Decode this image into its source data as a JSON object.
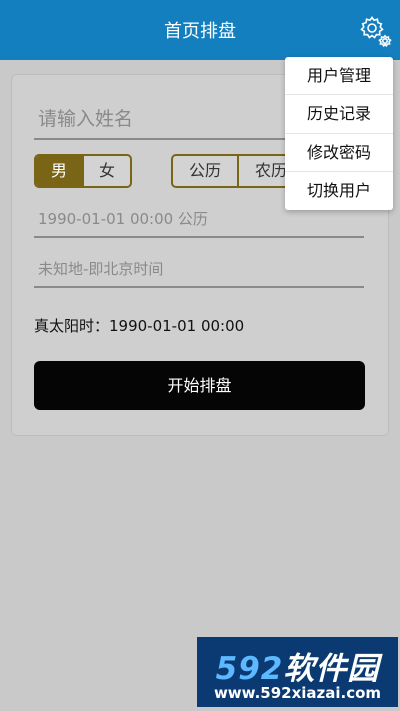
{
  "header": {
    "title": "首页排盘",
    "settings_icon": "gear-icon"
  },
  "form": {
    "name_placeholder": "请输入姓名",
    "gender_options": [
      "男",
      "女"
    ],
    "gender_selected": "男",
    "calendar_options": [
      "公历",
      "农历"
    ],
    "calendar_selected": "公历",
    "birth_datetime": "1990-01-01 00:00 公历",
    "birth_place": "未知地-即北京时间",
    "true_solar_time": "真太阳时：1990-01-01 00:00",
    "start_button": "开始排盘"
  },
  "menu": {
    "items": [
      "用户管理",
      "历史记录",
      "修改密码",
      "切换用户"
    ]
  },
  "watermark": {
    "brand_number": "592",
    "brand_text": "软件园",
    "url": "www.592xiazai.com"
  },
  "colors": {
    "header": "#147fbe",
    "accent_gold": "#7a6517",
    "button_black": "#050505",
    "overlay_gray": "#c9c9c9"
  }
}
